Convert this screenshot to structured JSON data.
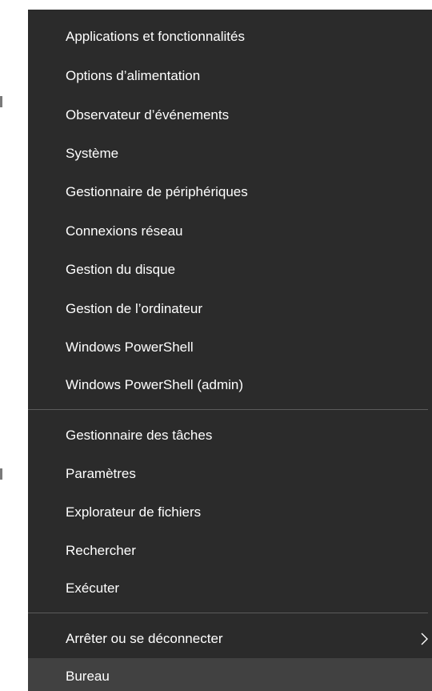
{
  "menu": {
    "group1": [
      "Applications et fonctionnalités",
      "Options d’alimentation",
      "Observateur d’événements",
      "Système",
      "Gestionnaire de périphériques",
      "Connexions réseau",
      "Gestion du disque",
      "Gestion de l’ordinateur",
      "Windows PowerShell",
      "Windows PowerShell (admin)"
    ],
    "group2": [
      "Gestionnaire des tâches",
      "Paramètres",
      "Explorateur de fichiers",
      "Rechercher",
      "Exécuter"
    ],
    "group3": [
      "Arrêter ou se déconnecter",
      "Bureau"
    ]
  },
  "colors": {
    "menu_bg": "#2b2b2b",
    "highlight_bg": "#414141",
    "text": "#ffffff",
    "divider": "#5c5c5c"
  },
  "icons": {
    "submenu": "chevron-right-icon"
  }
}
